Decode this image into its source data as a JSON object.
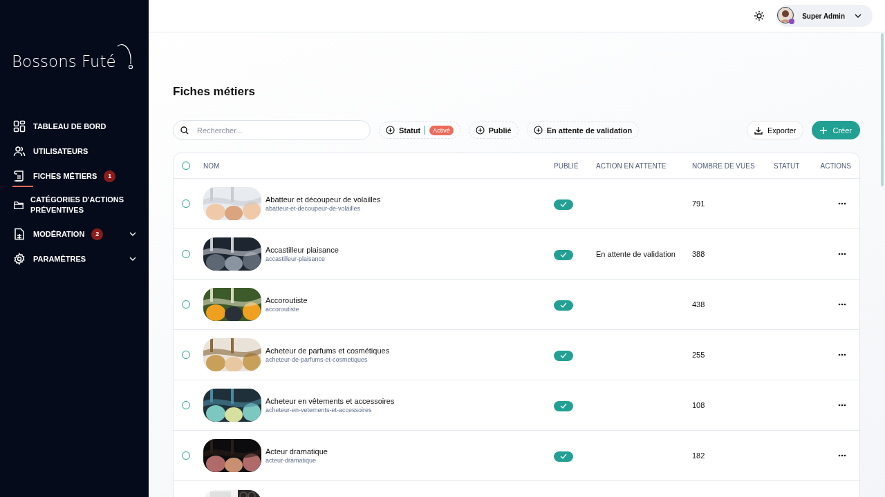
{
  "sidebar": {
    "logo": "Bossons Futé",
    "items": [
      {
        "label": "TABLEAU DE BORD",
        "selected": false,
        "expandable": false
      },
      {
        "label": "UTILISATEURS",
        "selected": false,
        "expandable": false
      },
      {
        "label": "FICHES MÉTIERS",
        "badge": "1",
        "selected": true,
        "expandable": false
      },
      {
        "label": "CATÉGORIES D'ACTIONS PRÉVENTIVES",
        "selected": false,
        "expandable": false
      },
      {
        "label": "MODÉRATION",
        "badge": "2",
        "selected": false,
        "expandable": true
      },
      {
        "label": "PARAMÈTRES",
        "selected": false,
        "expandable": true
      }
    ]
  },
  "topbar": {
    "user": "Super Admin"
  },
  "page": {
    "title": "Fiches métiers"
  },
  "toolbar": {
    "search": {
      "placeholder": "Rechercher..."
    },
    "filters": [
      {
        "label": "Statut",
        "value": "Activé"
      },
      {
        "label": "Publié"
      },
      {
        "label": "En attente de validation"
      }
    ],
    "export": "Exporter",
    "create": "Créer"
  },
  "table": {
    "select_all": {
      "selected": false
    },
    "columns": [
      "NOM",
      "PUBLIÉ",
      "ACTION EN ATTENTE",
      "NOMBRE DE VUES",
      "STATUT",
      "ACTIONS"
    ],
    "rows": [
      {
        "name": "Abatteur et découpeur de volailles",
        "slug": "abatteur-et-decoupeur-de-volailles",
        "published": true,
        "views": "791",
        "selected": false
      },
      {
        "name": "Accastilleur plaisance",
        "slug": "accastilleur-plaisance",
        "published": true,
        "pending": "En attente de validation",
        "views": "388",
        "selected": false
      },
      {
        "name": "Accoroutiste",
        "slug": "accoroutiste",
        "published": true,
        "views": "438",
        "selected": false
      },
      {
        "name": "Acheteur de parfums et cosmétiques",
        "slug": "acheteur-de-parfums-et-cosmetiques",
        "published": true,
        "views": "255",
        "selected": false
      },
      {
        "name": "Acheteur en vêtements et accessoires",
        "slug": "acheteur-en-vetements-et-accessoires",
        "published": true,
        "views": "108",
        "selected": false
      },
      {
        "name": "Acteur dramatique",
        "slug": "acteur-dramatique",
        "published": true,
        "views": "182",
        "selected": false
      }
    ]
  }
}
